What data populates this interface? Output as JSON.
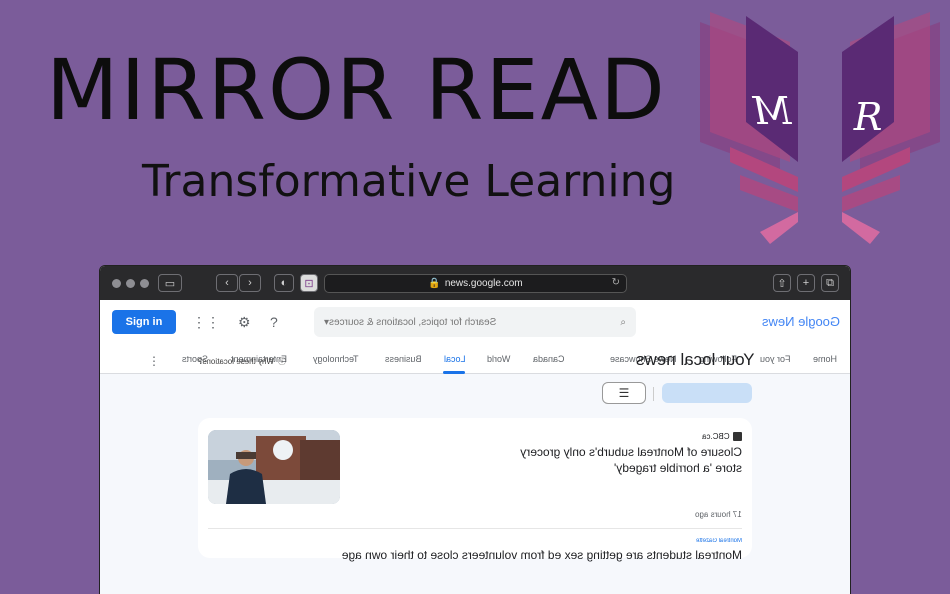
{
  "hero": {
    "title": "MIRROR READ",
    "subtitle": "Transformative Learning",
    "logo_letters": [
      "M",
      "R"
    ]
  },
  "browser": {
    "url": "news.google.com",
    "toolbar_icons": [
      "sidebar-icon",
      "back-icon",
      "forward-icon",
      "shield-icon",
      "extension-icon",
      "share-icon",
      "new-tab-icon",
      "tabs-icon"
    ]
  },
  "header": {
    "sign_in": "Sign in",
    "search_placeholder": "Search for topics, locations & sources",
    "logo_text": "Google News"
  },
  "nav": {
    "items": [
      {
        "label": "Home"
      },
      {
        "label": "For you"
      },
      {
        "label": "Following"
      },
      {
        "label": "News Showcase"
      },
      {
        "label": "Canada"
      },
      {
        "label": "World"
      },
      {
        "label": "Local"
      },
      {
        "label": "Business"
      },
      {
        "label": "Technology"
      },
      {
        "label": "Entertainment"
      },
      {
        "label": "Sports"
      }
    ],
    "active": "Local"
  },
  "main": {
    "heading": "Your local news",
    "why_link": "Why these locations?"
  },
  "story": {
    "source": "CBC.ca",
    "headline": "Closure of Montreal suburb's only grocery store 'a horrible tragedy'",
    "time": "17 hours ago",
    "source2": "Montreal Gazette",
    "headline2": "Montreal students are getting sex ed from volunteers close to their own age"
  },
  "colors": {
    "background": "#7b5c9a",
    "accent": "#1a73e8",
    "logo_dark": "#5a2a74",
    "logo_mid": "#8a3a7c",
    "logo_pink": "#b3477e"
  }
}
